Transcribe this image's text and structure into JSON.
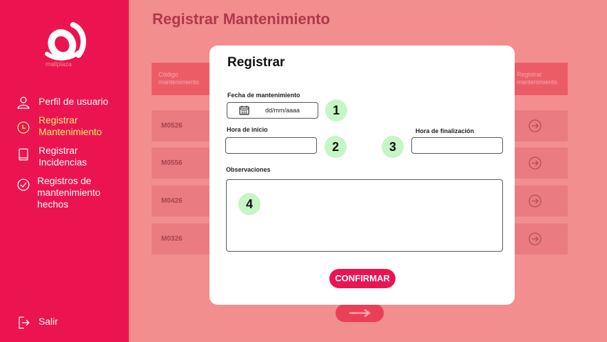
{
  "sidebar": {
    "logo_text": "mallplaza",
    "items": [
      {
        "label": "Perfil de usuario",
        "icon": "user-icon"
      },
      {
        "label": "Registrar Mantenimiento",
        "icon": "clock-icon",
        "active": true
      },
      {
        "label": "Registrar Incidencias",
        "icon": "book-icon"
      },
      {
        "label": "Registros de mantenimiento hechos",
        "icon": "check-circle-icon"
      }
    ],
    "logout_label": "Salir",
    "logout_icon": "logout-icon"
  },
  "main": {
    "title": "Registrar Mantenimiento",
    "table": {
      "headers": [
        "Código mantenimiento",
        "Registrar mantenimiento"
      ],
      "rows": [
        {
          "code": "M0526"
        },
        {
          "code": "M0556"
        },
        {
          "code": "M0426"
        },
        {
          "code": "M0326"
        }
      ]
    }
  },
  "modal": {
    "title": "Registrar",
    "fecha_label": "Fecha de mantenimiento",
    "fecha_placeholder": "dd/mm/aaaa",
    "hora_inicio_label": "Hora de inicio",
    "hora_inicio_value": "",
    "hora_fin_label": "Hora de finalización",
    "hora_fin_value": "",
    "observaciones_label": "Observaciones",
    "observaciones_value": "",
    "confirm_label": "CONFIRMAR",
    "badges": [
      "1",
      "2",
      "3",
      "4"
    ]
  },
  "colors": {
    "sidebar": "#EC1450",
    "active_nav": "#F7F46A",
    "overlay": "#F28E8E",
    "badge": "#C6F5C6"
  }
}
